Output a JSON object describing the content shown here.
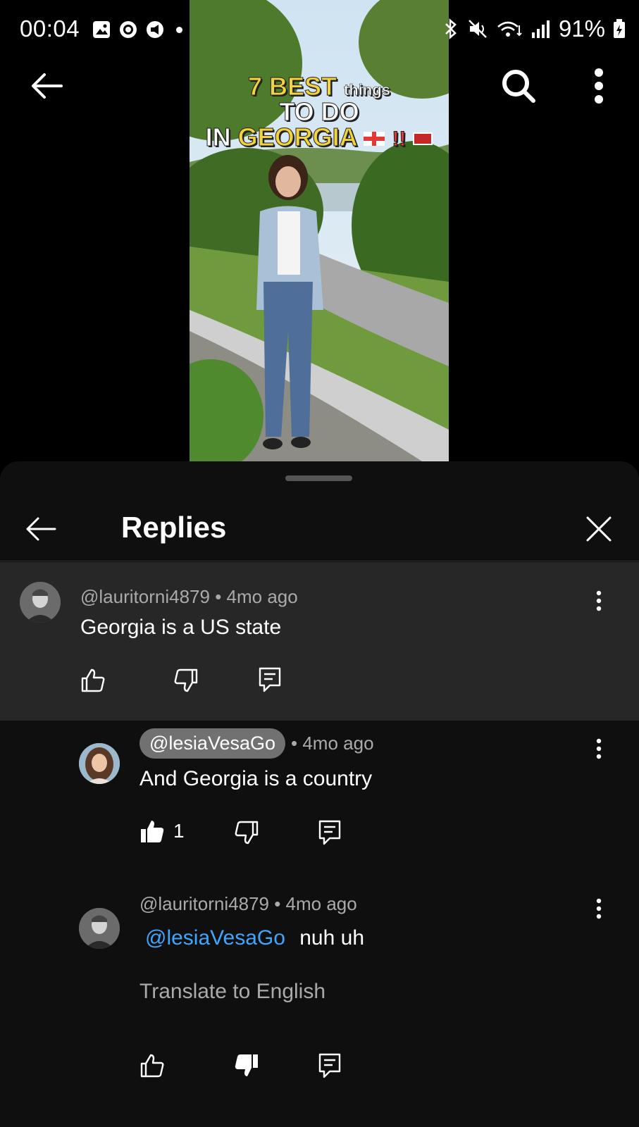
{
  "status_bar": {
    "time": "00:04",
    "battery": "91%"
  },
  "video": {
    "title_line1_big": "7 BEST",
    "title_line1_small": "things",
    "title_line2": "TO DO",
    "title_line3_a": "IN",
    "title_line3_b": "GEORGIA",
    "title_line3_c": "!!"
  },
  "sheet": {
    "title": "Replies"
  },
  "parent_comment": {
    "author": "@lauritorni4879",
    "age": "• 4mo ago",
    "text": "Georgia is a US state"
  },
  "replies": [
    {
      "author": "@lesiaVesaGo",
      "age": "• 4mo ago",
      "text": "And Georgia is a country",
      "like_count": "1"
    },
    {
      "author": "@lauritorni4879",
      "age": "• 4mo ago",
      "mention": "@lesiaVesaGo",
      "text": "nuh uh",
      "translate_label": "Translate to English"
    }
  ],
  "colors": {
    "sheet_bg": "#0f0f0f",
    "highlight_bg": "#272727",
    "mention": "#3ea6ff",
    "meta": "#aaaaaa"
  }
}
